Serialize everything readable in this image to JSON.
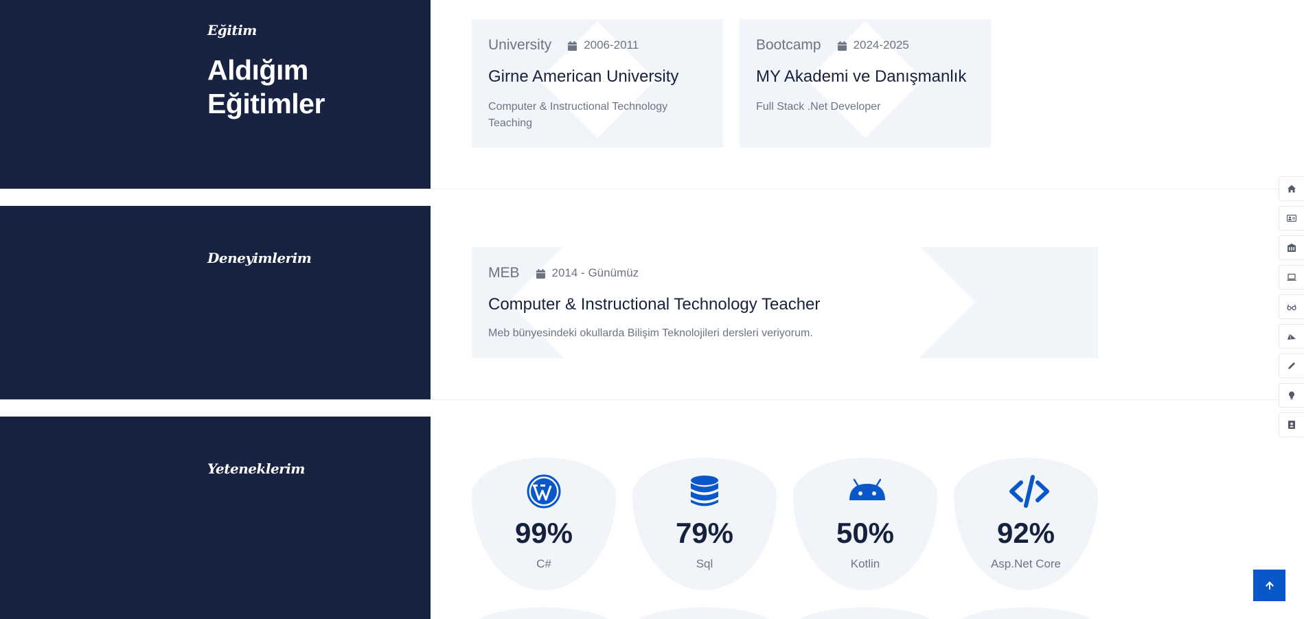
{
  "education": {
    "eyebrow": "Eğitim",
    "heading_line1": "Aldığım",
    "heading_line2": "Eğitimler",
    "cards": [
      {
        "kind": "University",
        "date": "2006-2011",
        "title": "Girne American University",
        "desc_line1": "Computer & Instructional Technology",
        "desc_line2": "Teaching"
      },
      {
        "kind": "Bootcamp",
        "date": "2024-2025",
        "title": "MY Akademi ve Danışmanlık",
        "desc_line1": "Full Stack .Net Developer",
        "desc_line2": ""
      }
    ]
  },
  "experience": {
    "eyebrow": "Deneyimlerim",
    "cards": [
      {
        "kind": "MEB",
        "date": "2014 - Günümüz",
        "title": "Computer & Instructional Technology Teacher",
        "desc_line1": "Meb bünyesindeki okullarda Bilişim Teknolojileri dersleri veriyorum."
      }
    ]
  },
  "skills": {
    "eyebrow": "Yeteneklerim",
    "items": [
      {
        "percent": "99%",
        "name": "C#",
        "icon": "wordpress-icon"
      },
      {
        "percent": "79%",
        "name": "Sql",
        "icon": "database-icon"
      },
      {
        "percent": "50%",
        "name": "Kotlin",
        "icon": "android-icon"
      },
      {
        "percent": "92%",
        "name": "Asp.Net Core",
        "icon": "code-icon"
      }
    ]
  },
  "side_nav": {
    "items": [
      "home-icon",
      "id-card-icon",
      "school-icon",
      "laptop-icon",
      "glasses-icon",
      "paper-plane-icon",
      "pencil-icon",
      "lightbulb-icon",
      "contact-book-icon"
    ]
  },
  "colors": {
    "sidebar": "#172340",
    "card": "#f1f4f9",
    "accent": "#0a57c9",
    "heading_text": "#16223d",
    "muted_text": "#6c7383"
  }
}
